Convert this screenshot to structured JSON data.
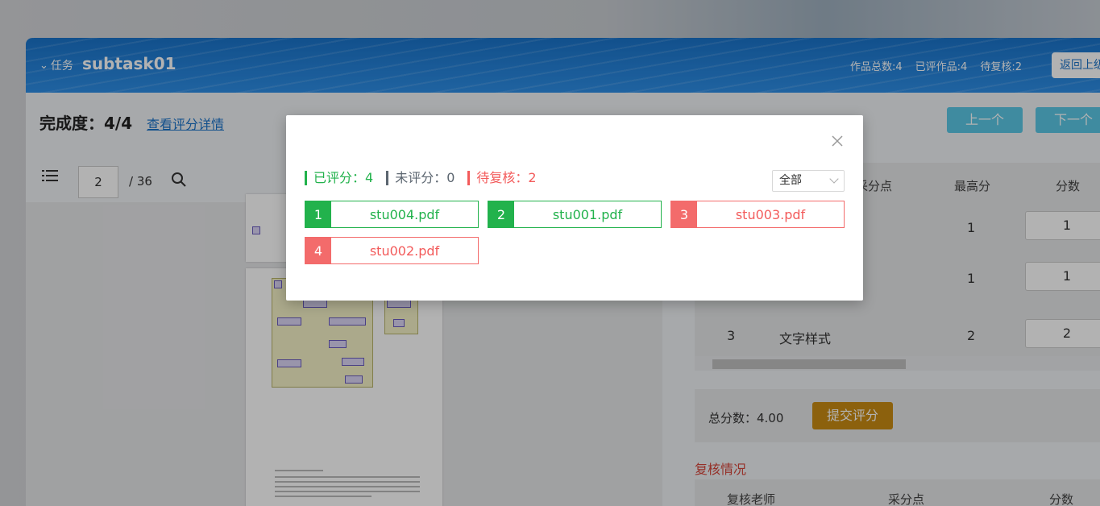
{
  "header": {
    "task_tag": "任务",
    "task_title": "subtask01",
    "stats": [
      "作品总数:4",
      "已评作品:4",
      "待复核:2"
    ],
    "back_label": "返回上级"
  },
  "progress": {
    "label": "完成度：4/4",
    "detail_link": "查看评分详情"
  },
  "nav": {
    "prev": "上一个",
    "next": "下一个"
  },
  "viewer": {
    "page_value": "2",
    "page_total": "/ 36"
  },
  "score_table": {
    "headers": [
      "采分点",
      "最高分",
      "分数"
    ],
    "rows": [
      {
        "index": "",
        "name": "",
        "max": "1",
        "score": "1"
      },
      {
        "index": "",
        "name": "",
        "max": "1",
        "score": "1"
      },
      {
        "index": "3",
        "name": "文字样式",
        "max": "2",
        "score": "2"
      }
    ]
  },
  "summary": {
    "total": "总分数：4.00",
    "submit": "提交评分"
  },
  "review": {
    "title": "复核情况",
    "headers": [
      "复核老师",
      "采分点",
      "分数"
    ]
  },
  "modal": {
    "legend": {
      "done": "已评分：4",
      "none": "未评分：0",
      "review": "待复核：2"
    },
    "filter": "全部",
    "files": [
      {
        "index": "1",
        "name": "stu004.pdf",
        "status": "green"
      },
      {
        "index": "2",
        "name": "stu001.pdf",
        "status": "green"
      },
      {
        "index": "3",
        "name": "stu003.pdf",
        "status": "red"
      },
      {
        "index": "4",
        "name": "stu002.pdf",
        "status": "red"
      }
    ]
  },
  "colors": {
    "header": "#1a73c9",
    "graded": "#22b24c",
    "review": "#f36b6b",
    "submit": "#c98c13"
  }
}
